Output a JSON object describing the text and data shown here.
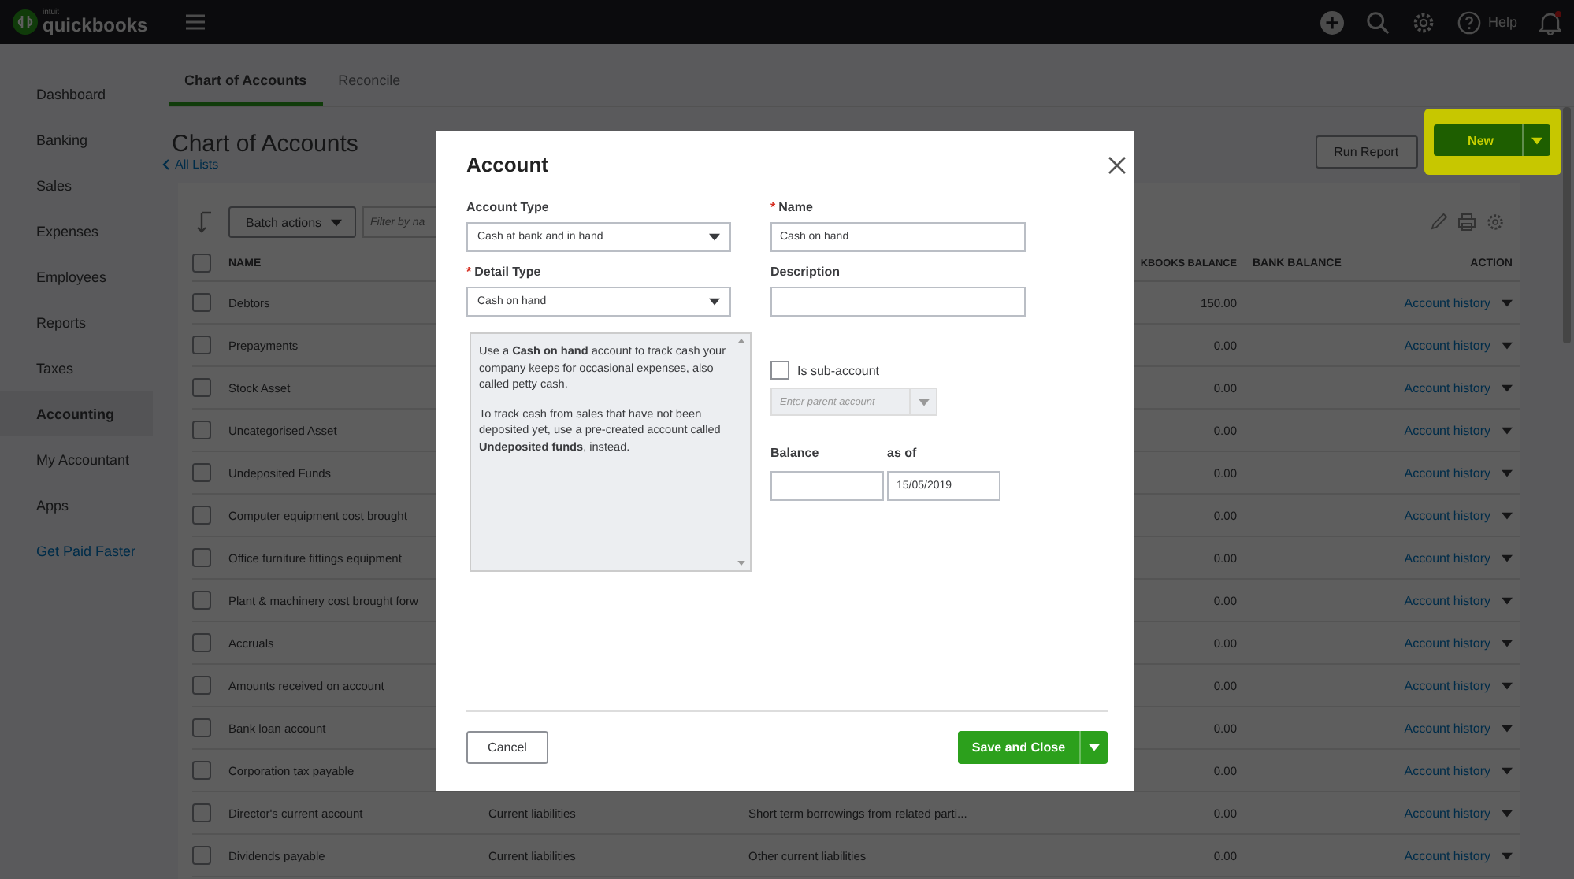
{
  "topbar": {
    "brand_small": "intuit",
    "brand": "quickbooks",
    "help": "Help",
    "notification_dot": true
  },
  "sidebar": {
    "items": [
      {
        "label": "Dashboard",
        "selected": false,
        "kind": "nav"
      },
      {
        "label": "Banking",
        "selected": false,
        "kind": "nav"
      },
      {
        "label": "Sales",
        "selected": false,
        "kind": "nav"
      },
      {
        "label": "Expenses",
        "selected": false,
        "kind": "nav"
      },
      {
        "label": "Employees",
        "selected": false,
        "kind": "nav"
      },
      {
        "label": "Reports",
        "selected": false,
        "kind": "nav"
      },
      {
        "label": "Taxes",
        "selected": false,
        "kind": "nav"
      },
      {
        "label": "Accounting",
        "selected": true,
        "kind": "nav"
      },
      {
        "label": "My Accountant",
        "selected": false,
        "kind": "nav"
      },
      {
        "label": "Apps",
        "selected": false,
        "kind": "nav"
      },
      {
        "label": "Get Paid Faster",
        "selected": false,
        "kind": "link"
      }
    ]
  },
  "tabs": [
    {
      "label": "Chart of Accounts",
      "selected": true
    },
    {
      "label": "Reconcile",
      "selected": false
    }
  ],
  "page": {
    "title": "Chart of Accounts",
    "back_link": "All Lists",
    "run_report": "Run Report",
    "new_button": {
      "label": "New",
      "highlighted": true
    }
  },
  "toolbar": {
    "batch_actions": "Batch actions",
    "filter_placeholder": "Filter by na"
  },
  "table": {
    "select_all_checked": false,
    "headers": {
      "name": "NAME",
      "balance": "KBOOKS BALANCE",
      "bank_balance": "BANK BALANCE",
      "action": "ACTION"
    },
    "rows": [
      {
        "name": "Debtors",
        "balance": "150.00",
        "action": "Account history",
        "checked": false
      },
      {
        "name": "Prepayments",
        "balance": "0.00",
        "action": "Account history",
        "checked": false
      },
      {
        "name": "Stock Asset",
        "balance": "0.00",
        "action": "Account history",
        "checked": false
      },
      {
        "name": "Uncategorised Asset",
        "balance": "0.00",
        "action": "Account history",
        "checked": false
      },
      {
        "name": "Undeposited Funds",
        "balance": "0.00",
        "action": "Account history",
        "checked": false
      },
      {
        "name": "Computer equipment cost brought",
        "balance": "0.00",
        "action": "Account history",
        "checked": false
      },
      {
        "name": "Office furniture fittings equipment",
        "balance": "0.00",
        "action": "Account history",
        "checked": false
      },
      {
        "name": "Plant & machinery cost brought forw",
        "balance": "0.00",
        "action": "Account history",
        "checked": false
      },
      {
        "name": "Accruals",
        "balance": "0.00",
        "action": "Account history",
        "checked": false
      },
      {
        "name": "Amounts received on account",
        "balance": "0.00",
        "action": "Account history",
        "checked": false
      },
      {
        "name": "Bank loan account",
        "balance": "0.00",
        "action": "Account history",
        "checked": false
      },
      {
        "name": "Corporation tax payable",
        "balance": "0.00",
        "action": "Account history",
        "checked": false
      },
      {
        "name": "Director's current account",
        "type": "Current liabilities",
        "detail_type": "Short term borrowings from related parti...",
        "balance": "0.00",
        "action": "Account history",
        "checked": false
      },
      {
        "name": "Dividends payable",
        "type": "Current liabilities",
        "detail_type": "Other current liabilities",
        "balance": "0.00",
        "action": "Account history",
        "checked": false
      }
    ]
  },
  "dialog": {
    "title": "Account",
    "account_type": {
      "label": "Account Type",
      "value": "Cash at bank and in hand"
    },
    "detail_type": {
      "label": "Detail Type",
      "value": "Cash on hand",
      "required_mark": "*"
    },
    "help_paragraphs": [
      "Use a **Cash on hand** account to track cash your company keeps for occasional expenses, also called petty cash.",
      "To track cash from sales that have not been deposited yet, use a pre-created account called **Undeposited funds**, instead."
    ],
    "name": {
      "label": "Name",
      "value": "Cash on hand",
      "required_mark": "*"
    },
    "description": {
      "label": "Description"
    },
    "sub_account": {
      "label": "Is sub-account",
      "checked": false
    },
    "parent_account": {
      "placeholder": "Enter parent account",
      "disabled": true
    },
    "balance": {
      "label": "Balance"
    },
    "as_of": {
      "label": "as of",
      "value": "15/05/2019"
    },
    "cancel": "Cancel",
    "save": "Save and Close"
  }
}
